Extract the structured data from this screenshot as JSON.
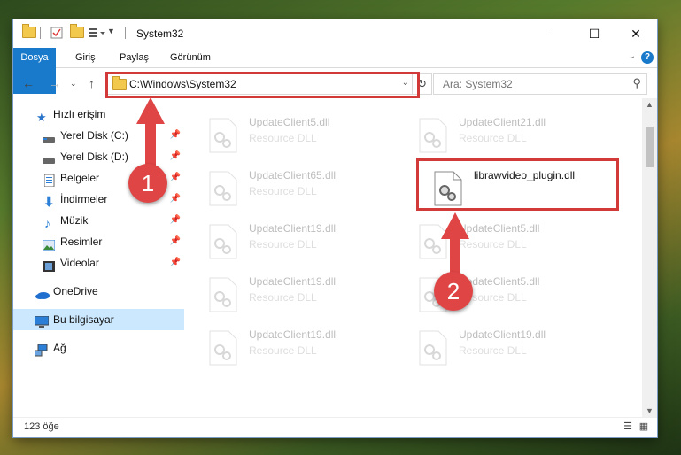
{
  "window": {
    "title": "System32"
  },
  "controls": {
    "minimize": "—",
    "maximize": "☐",
    "close": "✕"
  },
  "ribbon": {
    "tabs": [
      "Dosya",
      "Giriş",
      "Paylaş",
      "Görünüm"
    ]
  },
  "address": {
    "path": "C:\\Windows\\System32"
  },
  "search": {
    "placeholder": "Ara: System32"
  },
  "sidebar": {
    "items": [
      {
        "label": "Hızlı erişim",
        "icon": "star-icon"
      },
      {
        "label": "Yerel Disk (C:)",
        "icon": "drive-icon"
      },
      {
        "label": "Yerel Disk (D:)",
        "icon": "drive-icon"
      },
      {
        "label": "Belgeler",
        "icon": "document-icon"
      },
      {
        "label": "İndirmeler",
        "icon": "download-icon"
      },
      {
        "label": "Müzik",
        "icon": "music-icon"
      },
      {
        "label": "Resimler",
        "icon": "picture-icon"
      },
      {
        "label": "Videolar",
        "icon": "video-icon"
      },
      {
        "label": "OneDrive",
        "icon": "cloud-icon"
      },
      {
        "label": "Bu bilgisayar",
        "icon": "computer-icon"
      },
      {
        "label": "Ağ",
        "icon": "network-icon"
      }
    ]
  },
  "files": [
    {
      "name": "UpdateClient5.dll",
      "type": "Resource DLL"
    },
    {
      "name": "UpdateClient21.dll",
      "type": "Resource DLL"
    },
    {
      "name": "UpdateClient65.dll",
      "type": "Resource DLL"
    },
    {
      "name": "librawvideo_plugin.dll",
      "type": ""
    },
    {
      "name": "UpdateClient19.dll",
      "type": "Resource DLL"
    },
    {
      "name": "UpdateClient5.dll",
      "type": "Resource DLL"
    },
    {
      "name": "UpdateClient19.dll",
      "type": "Resource DLL"
    },
    {
      "name": "UpdateClient5.dll",
      "type": "Resource DLL"
    },
    {
      "name": "UpdateClient19.dll",
      "type": "Resource DLL"
    },
    {
      "name": "UpdateClient19.dll",
      "type": "Resource DLL"
    }
  ],
  "status": {
    "count": "123 öğe"
  },
  "annotations": {
    "step1": "1",
    "step2": "2",
    "color": "#d23a3a"
  }
}
